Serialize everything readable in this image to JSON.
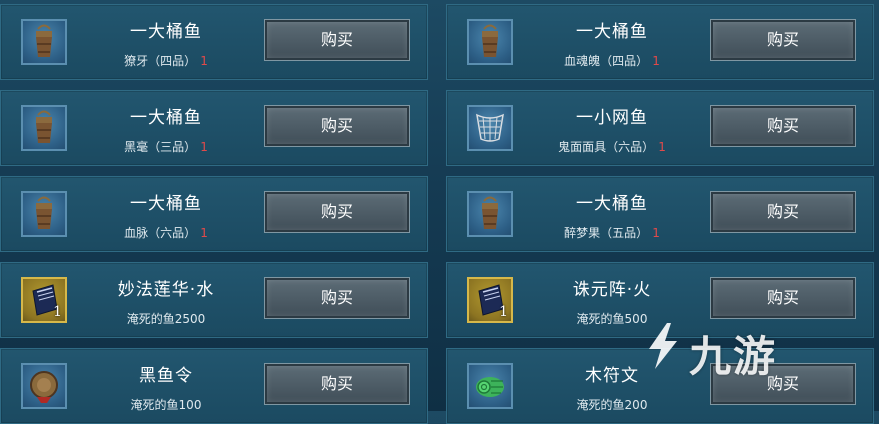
{
  "buy_label": "购买",
  "watermark_text": "九游",
  "left_column": [
    {
      "name": "一大桶鱼",
      "cost_item": "獠牙（四品）",
      "cost_qty": "1",
      "icon": "bucket-icon"
    },
    {
      "name": "一大桶鱼",
      "cost_item": "黑毫（三品）",
      "cost_qty": "1",
      "icon": "bucket-icon"
    },
    {
      "name": "一大桶鱼",
      "cost_item": "血脉（六品）",
      "cost_qty": "1",
      "icon": "bucket-icon"
    },
    {
      "name": "妙法莲华·水",
      "cost_item": "淹死的鱼2500",
      "cost_qty": "",
      "icon": "book-icon",
      "badge": "1"
    },
    {
      "name": "黑鱼令",
      "cost_item": "淹死的鱼100",
      "cost_qty": "",
      "icon": "token-icon"
    }
  ],
  "right_column": [
    {
      "name": "一大桶鱼",
      "cost_item": "血魂魄（四品）",
      "cost_qty": "1",
      "icon": "bucket-icon"
    },
    {
      "name": "一小网鱼",
      "cost_item": "鬼面面具（六品）",
      "cost_qty": "1",
      "icon": "net-icon"
    },
    {
      "name": "一大桶鱼",
      "cost_item": "醉梦果（五品）",
      "cost_qty": "1",
      "icon": "bucket-icon"
    },
    {
      "name": "诛元阵·火",
      "cost_item": "淹死的鱼500",
      "cost_qty": "",
      "icon": "book-icon",
      "badge": "1"
    },
    {
      "name": "木符文",
      "cost_item": "淹死的鱼200",
      "cost_qty": "",
      "icon": "scroll-icon"
    }
  ]
}
